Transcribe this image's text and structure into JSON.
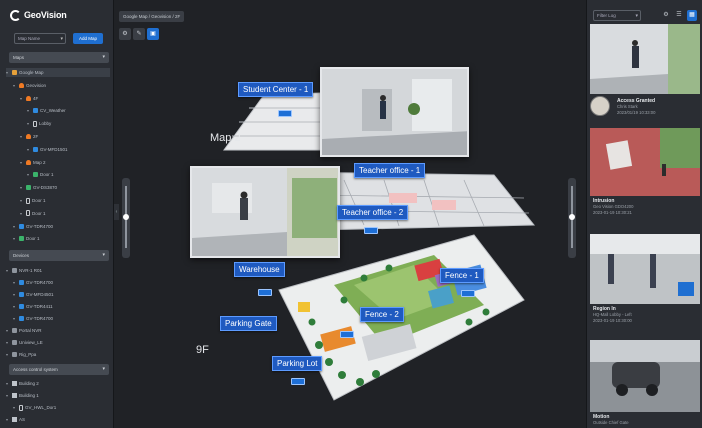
{
  "sidebar": {
    "logo_text": "GeoVision",
    "map_select_placeholder": "Map Name",
    "add_map_label": "Add Map",
    "maps_section": "Maps",
    "tree": [
      {
        "label": "Google Map",
        "icon": "map-icon",
        "depth": 0,
        "selected": true
      },
      {
        "label": "Geovision",
        "icon": "person-icon",
        "depth": 1
      },
      {
        "label": "4F",
        "icon": "person-icon",
        "depth": 2
      },
      {
        "label": "CV_Weather",
        "icon": "camera-icon",
        "depth": 3
      },
      {
        "label": "Lobby",
        "icon": "door-icon",
        "depth": 3
      },
      {
        "label": "2F",
        "icon": "person-icon",
        "depth": 2
      },
      {
        "label": "GV-MFD1501",
        "icon": "camera-icon",
        "depth": 3
      },
      {
        "label": "Map 2",
        "icon": "person-icon",
        "depth": 2
      },
      {
        "label": "Door 1",
        "icon": "camera-green-icon",
        "depth": 3
      },
      {
        "label": "GV-DS3870",
        "icon": "camera-green-icon",
        "depth": 2
      },
      {
        "label": "Door 1",
        "icon": "door-icon",
        "depth": 2
      },
      {
        "label": "Door 1",
        "icon": "door-icon",
        "depth": 2
      },
      {
        "label": "GV-TDR4700",
        "icon": "camera-icon",
        "depth": 1
      },
      {
        "label": "Door 1",
        "icon": "camera-green-icon",
        "depth": 1
      }
    ],
    "devices_section": "Devices",
    "devices": [
      {
        "label": "NVR-1 R01",
        "icon": "nvr-icon",
        "depth": 0
      },
      {
        "label": "GV-TDR4700",
        "icon": "camera-icon",
        "depth": 1
      },
      {
        "label": "GV-MFD4501",
        "icon": "camera-icon",
        "depth": 1
      },
      {
        "label": "GV-TDR4411",
        "icon": "camera-icon",
        "depth": 1
      },
      {
        "label": "GV-TDR4700",
        "icon": "camera-icon",
        "depth": 1
      },
      {
        "label": "Portal NVR",
        "icon": "nvr-icon",
        "depth": 0
      },
      {
        "label": "Uniview_LE",
        "icon": "nvr-icon",
        "depth": 0
      },
      {
        "label": "Rig_Ppa",
        "icon": "nvr-icon",
        "depth": 0
      }
    ],
    "access_section": "Access control system",
    "access": [
      {
        "label": "Building 2",
        "icon": "building-icon",
        "depth": 0
      },
      {
        "label": "Building 1",
        "icon": "building-icon",
        "depth": 0
      },
      {
        "label": "GV_HWL_Dor1",
        "icon": "door-icon",
        "depth": 1
      },
      {
        "label": "AS",
        "icon": "building-icon",
        "depth": 0
      }
    ]
  },
  "main": {
    "breadcrumb": "Google Map / Geovision / 2F",
    "tools": [
      "⚙",
      "✎",
      "▣"
    ],
    "floor_labels": {
      "top": "Map 2",
      "bottom": "9F"
    },
    "tags": {
      "student_center": "Student Center - 1",
      "teacher_office_1": "Teacher office - 1",
      "teacher_office_2": "Teacher office - 2",
      "warehouse": "Warehouse",
      "fence_1": "Fence - 1",
      "fence_2": "Fence - 2",
      "parking_gate": "Parking Gate",
      "parking_lot": "Parking Lot"
    }
  },
  "right_panel": {
    "filter_placeholder": "Filter Log",
    "events": [
      {
        "title": "",
        "sub1": "",
        "sub2": ""
      },
      {
        "title": "Access Granted",
        "sub1": "Chris Stark",
        "sub2": "2023/01/19 10:33:00"
      },
      {
        "title": "Intrusion",
        "sub1": "Geo Vision GDO4200",
        "sub2": "2023-01-19 10:30:21"
      },
      {
        "title": "Region In",
        "sub1": "HQ-Mall Lobby - Left",
        "sub2": "2023-01-19 10:30:00"
      },
      {
        "title": "Motion",
        "sub1": "Outside Chief Gate",
        "sub2": ""
      }
    ]
  },
  "colors": {
    "accent": "#1f6fd1",
    "tag_bg": "#1f5ac0",
    "panel": "#2a2d33",
    "canvas": "#202226"
  }
}
